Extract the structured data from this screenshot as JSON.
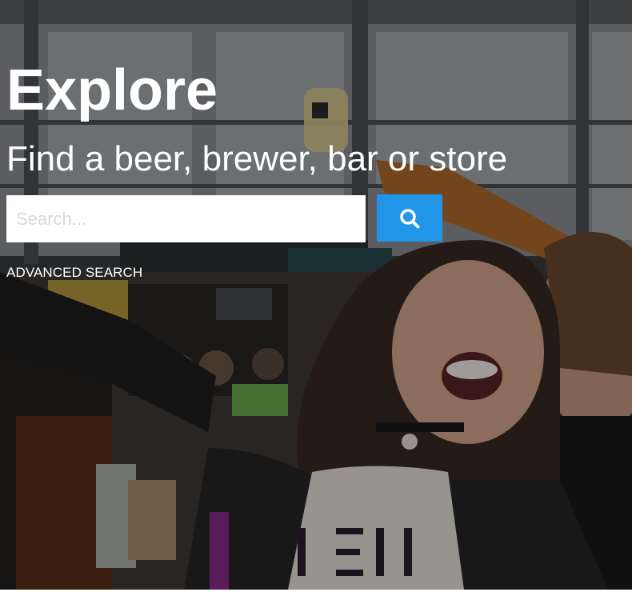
{
  "hero": {
    "title": "Explore",
    "subtitle": "Find a beer, brewer, bar or store",
    "background_image": "crowd-at-beer-festival-photo"
  },
  "search": {
    "placeholder": "Search...",
    "value": "",
    "button_icon": "search-icon",
    "button_color": "#2196e8"
  },
  "links": {
    "advanced_search": "ADVANCED SEARCH"
  },
  "colors": {
    "text": "#ffffff",
    "accent": "#2196e8",
    "input_background": "#ffffff",
    "placeholder": "#d8d8d8"
  }
}
